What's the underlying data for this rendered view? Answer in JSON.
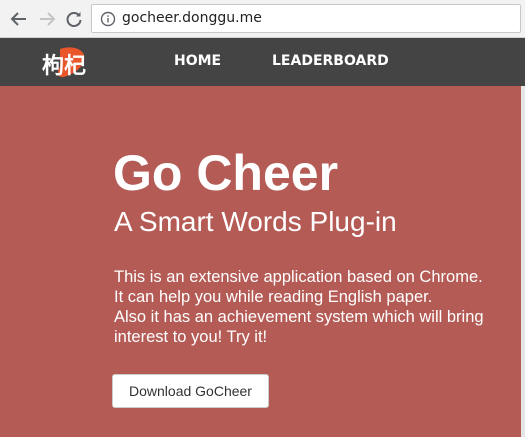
{
  "browser": {
    "url": "gocheer.donggu.me",
    "icons": [
      "back-arrow-icon",
      "forward-arrow-icon",
      "reload-icon",
      "info-icon"
    ]
  },
  "navbar": {
    "logo_text": "枸杞",
    "links": [
      {
        "label": "HOME"
      },
      {
        "label": "LEADERBOARD"
      }
    ],
    "background": "#444444"
  },
  "hero": {
    "title": "Go Cheer",
    "subtitle": "A Smart Words Plug-in",
    "description_lines": [
      "This is an extensive application based on Chrome.",
      "It can help you while reading English paper.",
      "Also it has an achievement system which will bring",
      "interest to you! Try it!"
    ],
    "download_label": "Download GoCheer",
    "background": "#b45b56"
  }
}
